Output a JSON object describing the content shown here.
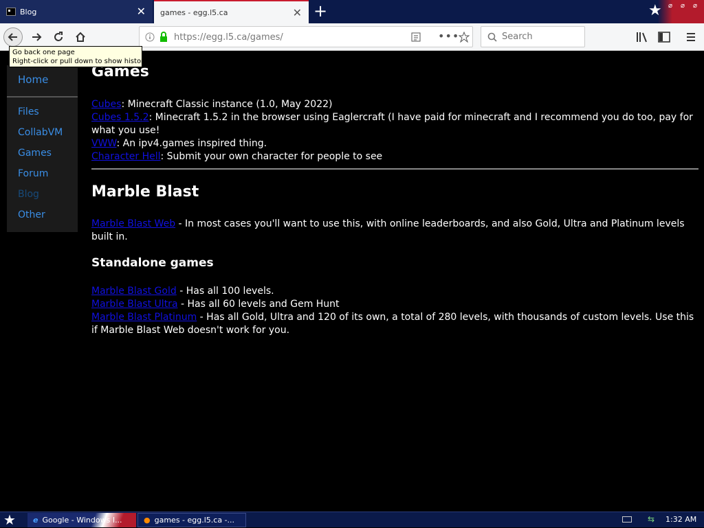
{
  "browser": {
    "tabs": [
      {
        "title": "Blog"
      },
      {
        "title": "games - egg.l5.ca"
      }
    ],
    "url": "https://egg.l5.ca/games/",
    "search_placeholder": "Search",
    "tooltip": {
      "line1": "Go back one page",
      "line2": "Right-click or pull down to show history"
    }
  },
  "sidebar": {
    "items": [
      {
        "label": "Home"
      },
      {
        "label": "Files"
      },
      {
        "label": "CollabVM"
      },
      {
        "label": "Games"
      },
      {
        "label": "Forum"
      },
      {
        "label": "Blog"
      },
      {
        "label": "Other"
      }
    ]
  },
  "page": {
    "title": "Games",
    "games": [
      {
        "link": "Cubes",
        "desc": ": Minecraft Classic instance (1.0, May 2022)"
      },
      {
        "link": "Cubes 1.5.2",
        "desc": ": Minecraft 1.5.2 in the browser using Eaglercraft (I have paid for minecraft and I recommend you do too, pay for what you use!"
      },
      {
        "link": "VWW",
        "desc": ": An ipv4.games inspired thing."
      },
      {
        "link": "Character Hell",
        "desc": ": Submit your own character for people to see"
      }
    ],
    "marble": {
      "heading": "Marble Blast",
      "web": {
        "link": "Marble Blast Web",
        "desc": " - In most cases you'll want to use this, with online leaderboards, and also Gold, Ultra and Platinum levels built in."
      },
      "standalone_heading": "Standalone games",
      "standalone": [
        {
          "link": "Marble Blast Gold",
          "desc": " - Has all 100 levels."
        },
        {
          "link": "Marble Blast Ultra",
          "desc": " - Has all 60 levels and Gem Hunt"
        },
        {
          "link": "Marble Blast Platinum",
          "desc": " - Has all Gold, Ultra and 120 of its own, a total of 280 levels, with thousands of custom levels. Use this if Marble Blast Web doesn't work for you."
        }
      ]
    }
  },
  "taskbar": {
    "tasks": [
      {
        "label": "Google - Windows I..."
      },
      {
        "label": "games - egg.l5.ca -..."
      }
    ],
    "clock": "1:32 AM"
  }
}
